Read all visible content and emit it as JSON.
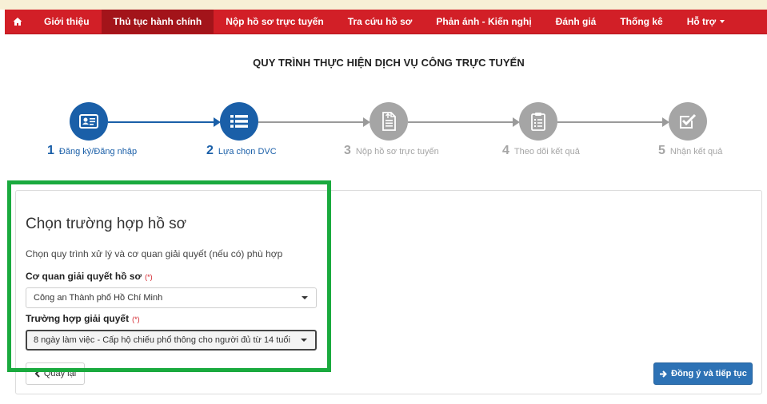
{
  "nav": {
    "items": [
      {
        "label": "Giới thiệu"
      },
      {
        "label": "Thủ tục hành chính"
      },
      {
        "label": "Nộp hồ sơ trực tuyến"
      },
      {
        "label": "Tra cứu hồ sơ"
      },
      {
        "label": "Phản ánh - Kiến nghị"
      },
      {
        "label": "Đánh giá"
      },
      {
        "label": "Thống kê"
      },
      {
        "label": "Hỗ trợ"
      }
    ],
    "active_index": 1
  },
  "page": {
    "title": "QUY TRÌNH THỰC HIỆN DỊCH VỤ CÔNG TRỰC TUYẾN"
  },
  "steps": [
    {
      "number": "1",
      "label": "Đăng ký/Đăng nhập",
      "status": "done",
      "icon": "id-card-icon"
    },
    {
      "number": "2",
      "label": "Lựa chọn DVC",
      "status": "done",
      "icon": "list-icon"
    },
    {
      "number": "3",
      "label": "Nộp hồ sơ trực tuyến",
      "status": "todo",
      "icon": "document-upload-icon"
    },
    {
      "number": "4",
      "label": "Theo dõi kết quả",
      "status": "todo",
      "icon": "clipboard-icon"
    },
    {
      "number": "5",
      "label": "Nhận kết quả",
      "status": "todo",
      "icon": "check-square-icon"
    }
  ],
  "form": {
    "title": "Chọn trường hợp hồ sơ",
    "description": "Chọn quy trình xử lý và cơ quan giải quyết (nếu có) phù hợp",
    "agency_label": "Cơ quan giải quyết hồ sơ",
    "agency_required": "(*)",
    "agency_value": "Công an Thành phố Hồ Chí Minh",
    "case_label": "Trường hợp giải quyết",
    "case_required": "(*)",
    "case_value": "8 ngày làm việc - Cấp hộ chiếu phổ thông cho người đủ từ 14 tuổi",
    "back_label": "Quay lại",
    "next_label": "Đồng ý và tiếp tục"
  },
  "colors": {
    "nav_bg": "#d21f27",
    "nav_active_bg": "#a3141a",
    "step_done": "#1a5fa8",
    "step_todo": "#a5a5a5",
    "primary_button": "#2d72b5",
    "highlight_box": "#1aaa3e"
  }
}
